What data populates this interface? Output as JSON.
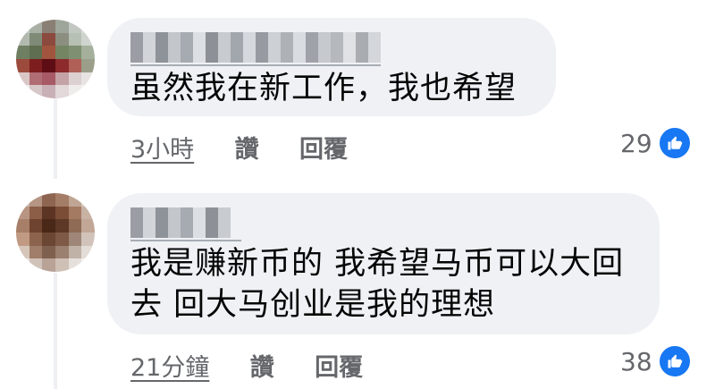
{
  "comments": [
    {
      "text_lines": [
        "虽然我在新工作，我也希望"
      ],
      "time": "3小時",
      "like_label": "讚",
      "reply_label": "回覆",
      "reaction_count": "29"
    },
    {
      "text_lines": [
        "我是赚新币的 我希望马币可以大回",
        "去 回大马创业是我的理想"
      ],
      "time": "21分鐘",
      "like_label": "讚",
      "reply_label": "回覆",
      "reaction_count": "38"
    }
  ],
  "colors": {
    "bubble": "#eff1f5",
    "like_blue": "#1877f2",
    "meta_text": "#65676b"
  },
  "icons": {
    "reaction": "thumbs-up-icon"
  }
}
